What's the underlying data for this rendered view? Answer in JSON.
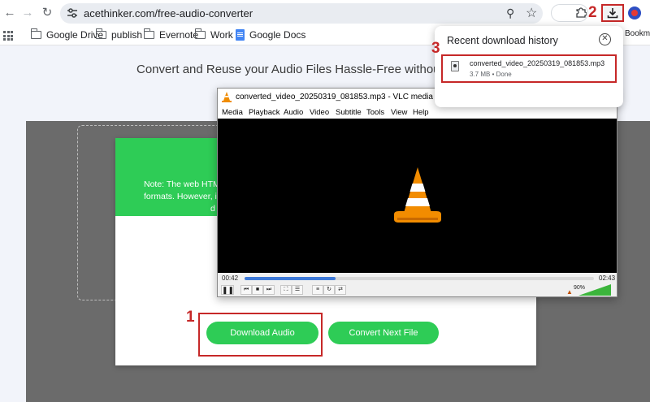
{
  "browser": {
    "url": "acethinker.com/free-audio-converter",
    "bookmarks": [
      "Google Drive",
      "publish",
      "Evernote",
      "Work",
      "Google Docs"
    ],
    "bookmarks_overflow": "Bookma"
  },
  "page": {
    "hero_title": "Convert and Reuse your Audio Files Hassle-Free without",
    "note_lines": [
      "Note: The web HTM",
      "formats. However, it d",
      "d"
    ],
    "download_button": "Download Audio",
    "convert_next_button": "Convert Next File"
  },
  "vlc": {
    "title": "converted_video_20250319_081853.mp3 - VLC media player",
    "menu": [
      "Media",
      "Playback",
      "Audio",
      "Video",
      "Subtitle",
      "Tools",
      "View",
      "Help"
    ],
    "time_elapsed": "00:42",
    "time_total": "02:43",
    "progress": 0.26,
    "volume": "90%"
  },
  "download_popup": {
    "title": "Recent download history",
    "file_name": "converted_video_20250319_081853.mp3",
    "file_meta": "3.7 MB • Done"
  },
  "annotations": {
    "step1": "1",
    "step2": "2",
    "step3": "3"
  },
  "colors": {
    "accent_green": "#2ecc56",
    "annotation_red": "#c62828",
    "vlc_orange": "#f08c00"
  }
}
